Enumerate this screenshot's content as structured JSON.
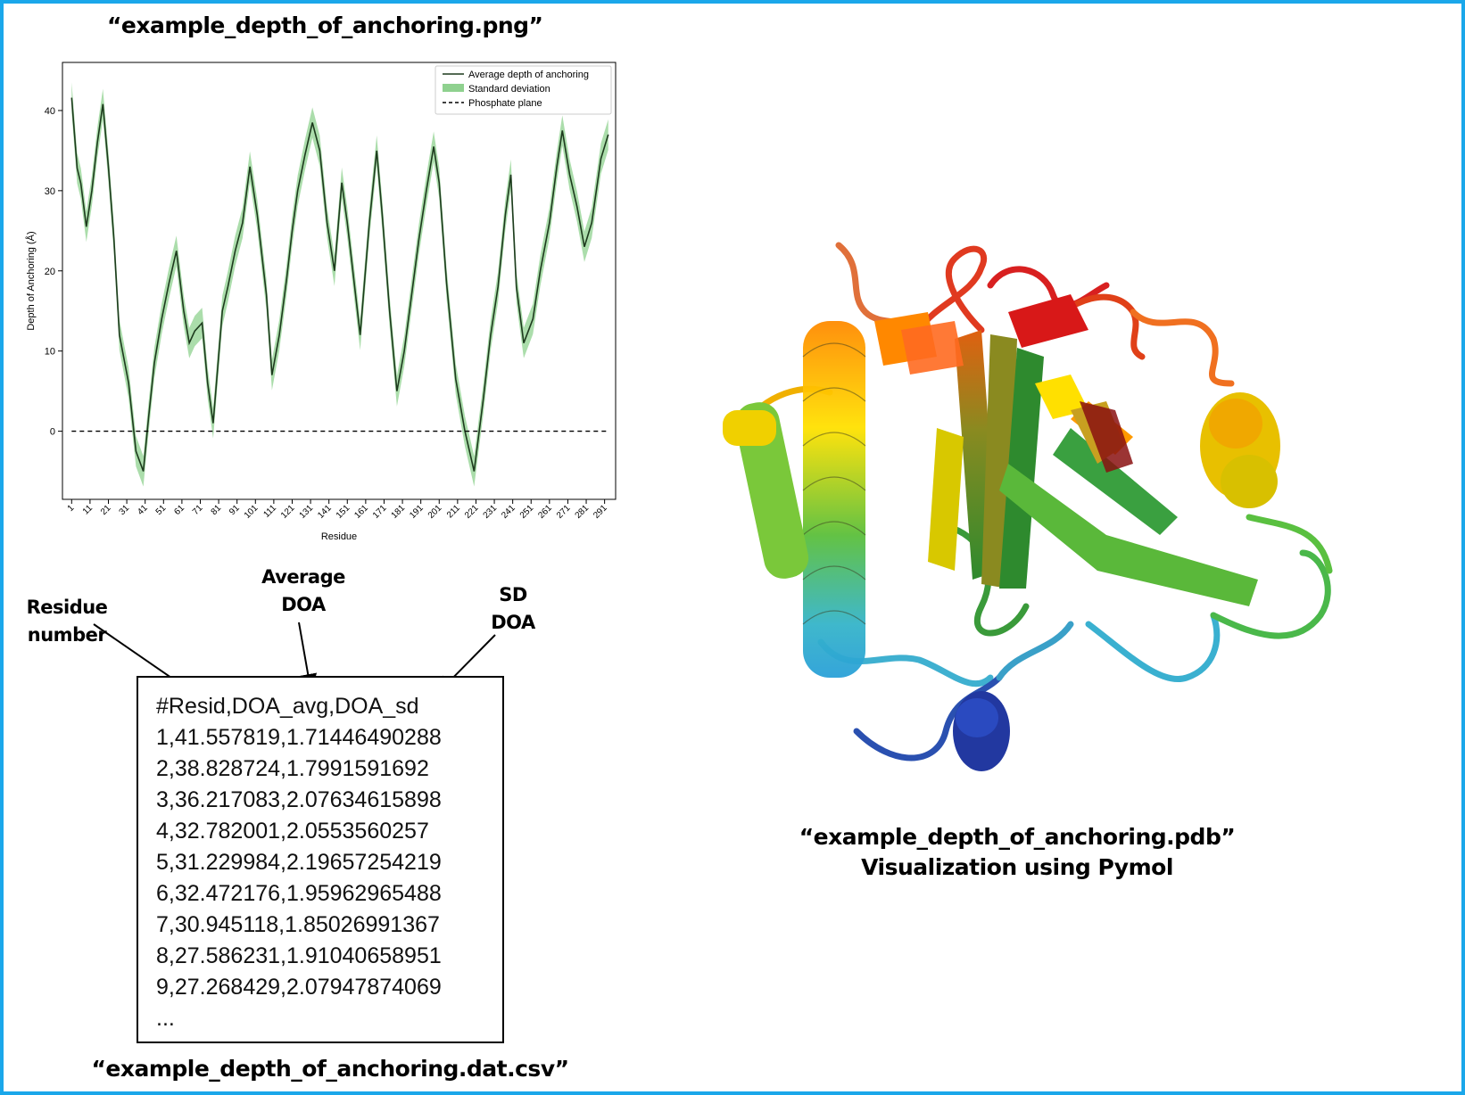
{
  "png_caption": "“example_depth_of_anchoring.png”",
  "csv_caption": "“example_depth_of_anchoring.dat.csv”",
  "pdb_caption": "“example_depth_of_anchoring.pdb”",
  "pdb_subcaption": "Visualization using Pymol",
  "annotations": {
    "residue": [
      "Residue",
      "number"
    ],
    "average": [
      "Average",
      "DOA"
    ],
    "sd": [
      "SD",
      "DOA"
    ]
  },
  "csv_lines": [
    "#Resid,DOA_avg,DOA_sd",
    "1,41.557819,1.71446490288",
    "2,38.828724,1.7991591692",
    "3,36.217083,2.07634615898",
    "4,32.782001,2.0553560257",
    "5,31.229984,2.19657254219",
    "6,32.472176,1.95962965488",
    "7,30.945118,1.85026991367",
    "8,27.586231,1.91040658951",
    "9,27.268429,2.07947874069",
    "..."
  ],
  "colors": {
    "frame": "#1aa7ea",
    "line": "#1d3a1d",
    "band": "#8fd18f"
  },
  "chart_data": {
    "type": "line",
    "title": "",
    "xlabel": "Residue",
    "ylabel": "Depth of Anchoring (Å)",
    "xlim": [
      -4,
      297
    ],
    "ylim": [
      -8.5,
      46
    ],
    "xticks": [
      1,
      11,
      21,
      31,
      41,
      51,
      61,
      71,
      81,
      91,
      101,
      111,
      121,
      131,
      141,
      151,
      161,
      171,
      181,
      191,
      201,
      211,
      221,
      231,
      241,
      251,
      261,
      271,
      281,
      291
    ],
    "yticks": [
      0,
      10,
      20,
      30,
      40
    ],
    "legend_position": "top-right",
    "series": [
      {
        "name": "Average depth of anchoring",
        "style": "solid",
        "x": [
          1,
          4,
          6,
          9,
          12,
          15,
          18,
          21,
          24,
          27,
          32,
          36,
          40,
          43,
          46,
          50,
          54,
          58,
          62,
          65,
          68,
          72,
          75,
          78,
          83,
          86,
          90,
          94,
          98,
          102,
          107,
          110,
          114,
          118,
          121,
          124,
          128,
          132,
          136,
          140,
          144,
          148,
          151,
          154,
          158,
          163,
          167,
          170,
          174,
          178,
          182,
          186,
          190,
          194,
          198,
          201,
          205,
          210,
          215,
          220,
          225,
          229,
          233,
          237,
          240,
          243,
          247,
          252,
          256,
          261,
          265,
          268,
          272,
          276,
          280,
          284,
          289,
          293
        ],
        "y": [
          41.6,
          32.8,
          30.9,
          25.5,
          30.0,
          36.0,
          40.8,
          33.0,
          24.0,
          12.0,
          6.0,
          -2.5,
          -5.0,
          2.0,
          8.5,
          14.0,
          18.5,
          22.5,
          15.0,
          11.0,
          12.5,
          13.5,
          6.0,
          1.0,
          15.0,
          18.0,
          22.5,
          26.0,
          33.0,
          27.0,
          17.0,
          7.0,
          12.0,
          19.0,
          25.0,
          30.0,
          34.5,
          38.5,
          35.0,
          26.0,
          20.0,
          31.0,
          26.0,
          20.0,
          12.0,
          26.0,
          35.0,
          27.0,
          15.0,
          5.0,
          10.0,
          17.0,
          24.0,
          30.0,
          35.5,
          31.0,
          18.5,
          6.5,
          0.0,
          -5.0,
          4.0,
          12.0,
          18.0,
          27.0,
          32.0,
          18.0,
          11.0,
          14.0,
          20.0,
          26.0,
          33.0,
          37.5,
          32.0,
          28.0,
          23.0,
          26.0,
          34.0,
          37.0
        ]
      },
      {
        "name": "Standard deviation",
        "style": "band",
        "sd_typical": 1.9
      },
      {
        "name": "Phosphate plane",
        "style": "dashed",
        "x": [
          1,
          293
        ],
        "y": [
          0,
          0
        ]
      }
    ]
  }
}
